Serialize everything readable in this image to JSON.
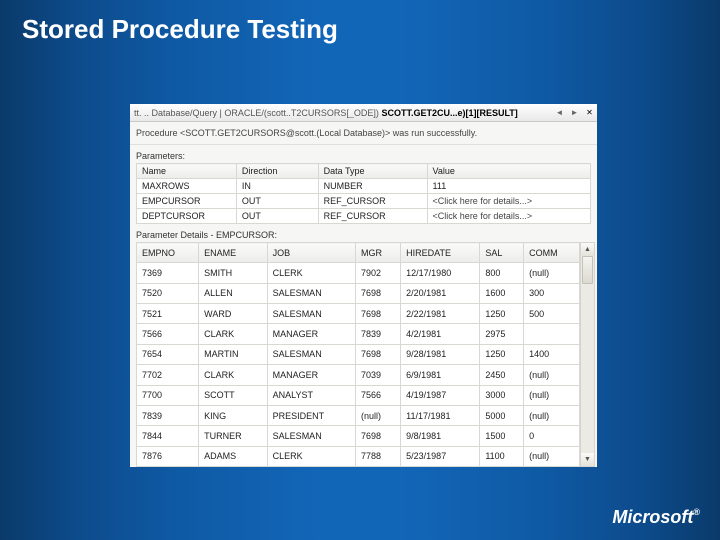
{
  "slide": {
    "title": "Stored Procedure Testing"
  },
  "titlebar": {
    "prefix": "tt. .. Database/Query | ORACLE/(scott..T2CURSORS[_ODE])",
    "bold": "SCOTT.GET2CU...e)[1][RESULT]"
  },
  "status": "Procedure <SCOTT.GET2CURSORS@scott.(Local Database)> was run successfully.",
  "params_label": "Parameters:",
  "params": {
    "headers": [
      "Name",
      "Direction",
      "Data Type",
      "Value"
    ],
    "rows": [
      [
        "MAXROWS",
        "IN",
        "NUMBER",
        "111"
      ],
      [
        "EMPCURSOR",
        "OUT",
        "REF_CURSOR",
        "<Click here for details...>"
      ],
      [
        "DEPTCURSOR",
        "OUT",
        "REF_CURSOR",
        "<Click here for details...>"
      ]
    ]
  },
  "details_label": "Parameter Details - EMPCURSOR:",
  "details": {
    "headers": [
      "EMPNO",
      "ENAME",
      "JOB",
      "MGR",
      "HIREDATE",
      "SAL",
      "COMM"
    ],
    "rows": [
      [
        "7369",
        "SMITH",
        "CLERK",
        "7902",
        "12/17/1980",
        "800",
        "(null)"
      ],
      [
        "7520",
        "ALLEN",
        "SALESMAN",
        "7698",
        "2/20/1981",
        "1600",
        "300"
      ],
      [
        "7521",
        "WARD",
        "SALESMAN",
        "7698",
        "2/22/1981",
        "1250",
        "500"
      ],
      [
        "7566",
        "CLARK",
        "MANAGER",
        "7839",
        "4/2/1981",
        "2975",
        ""
      ],
      [
        "7654",
        "MARTIN",
        "SALESMAN",
        "7698",
        "9/28/1981",
        "1250",
        "1400"
      ],
      [
        "7702",
        "CLARK",
        "MANAGER",
        "7039",
        "6/9/1981",
        "2450",
        "(null)"
      ],
      [
        "7700",
        "SCOTT",
        "ANALYST",
        "7566",
        "4/19/1987",
        "3000",
        "(null)"
      ],
      [
        "7839",
        "KING",
        "PRESIDENT",
        "(null)",
        "11/17/1981",
        "5000",
        "(null)"
      ],
      [
        "7844",
        "TURNER",
        "SALESMAN",
        "7698",
        "9/8/1981",
        "1500",
        "0"
      ],
      [
        "7876",
        "ADAMS",
        "CLERK",
        "7788",
        "5/23/1987",
        "1100",
        "(null)"
      ]
    ]
  },
  "logo": "Microsoft"
}
